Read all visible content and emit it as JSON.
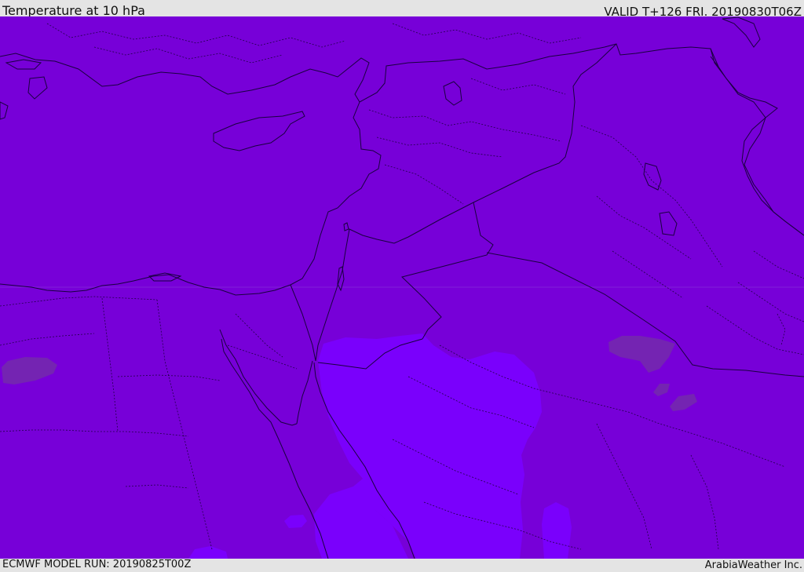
{
  "header": {
    "title": "Temperature at 10 hPa",
    "valid": "VALID T+126 FRI. 20190830T06Z"
  },
  "footer": {
    "model_run": "ECMWF MODEL RUN: 20190825T00Z",
    "credit": "ArabiaWeather Inc."
  },
  "colors": {
    "base_field": "#7700d8",
    "warm_field": "#7a00fc",
    "cool_patch": "#7424b2",
    "boundary_lines": "#1a0040",
    "bars": "#e4e4e4"
  }
}
